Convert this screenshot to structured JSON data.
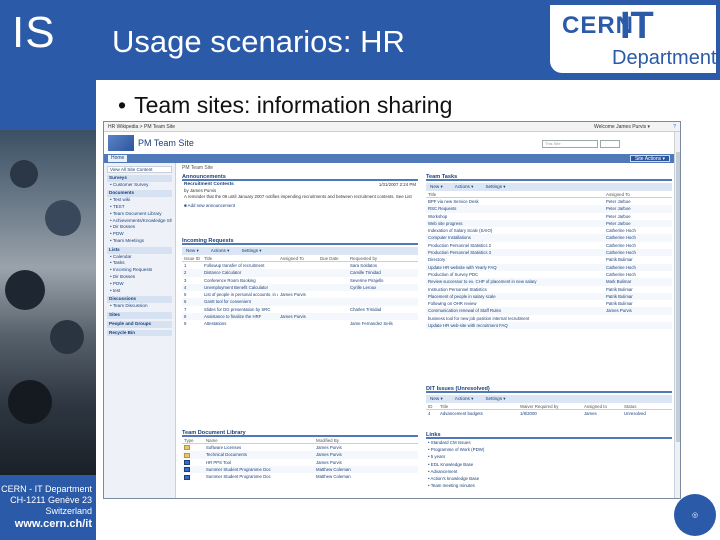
{
  "slide": {
    "logo": "IS",
    "title": "Usage scenarios: HR",
    "cern_logo": {
      "cern": "CERN",
      "it": "IT",
      "department": "Department"
    },
    "bullet": "Team sites: information sharing",
    "footer": {
      "line1": "CERN - IT Department",
      "line2": "CH-1211 Genève 23",
      "line3": "Switzerland",
      "web": "www.cern.ch/it"
    },
    "colors": {
      "brand_blue": "#2a5aa8",
      "sp_blue": "#4f79b8"
    }
  },
  "sharepoint": {
    "breadcrumb": "HR Wikipedia > PM Team Site",
    "welcome": "Welcome James Purvis ▾",
    "help_icon": "help-icon",
    "site_title": "PM Team Site",
    "search_placeholder": "This Site",
    "tab_home": "Home",
    "site_actions": "Site Actions ▾",
    "page_title": "PM Team Site",
    "quick_launch": {
      "view_all": "View All Site Content",
      "sections": [
        {
          "head": "Surveys",
          "items": [
            "Customer Survey"
          ]
        },
        {
          "head": "Documents",
          "items": [
            "Test wiki",
            "TEST",
            "Team Document Library",
            "Achievements/Knowledge Sharing",
            "Dir Bosses",
            "PDW",
            "Team Meetings"
          ]
        },
        {
          "head": "Lists",
          "items": [
            "Calendar",
            "Tasks",
            "Incoming Requests",
            "Dir Bosses",
            "PDW",
            "test"
          ]
        },
        {
          "head": "Discussions",
          "items": [
            "Team Discussion"
          ]
        },
        {
          "head": "Sites",
          "items": []
        },
        {
          "head": "People and Groups",
          "items": []
        },
        {
          "head": "Recycle Bin",
          "items": []
        }
      ]
    },
    "announcements": {
      "title": "Announcements",
      "item_title": "Recruitment Contests",
      "item_author": "by James Purvis",
      "item_date": "1/31/2007 2:24 PM",
      "item_body": "A reminder that the 06 until January 2007 notifies impending recruitments and between recruitment contests. See List",
      "add_link": "Add new announcement"
    },
    "incoming": {
      "title": "Incoming Requests",
      "toolbar": [
        "New ▾",
        "Actions ▾",
        "Settings ▾"
      ],
      "columns": [
        "Issue ID",
        "Title",
        "Assigned To",
        "Due Date",
        "Requested by"
      ],
      "rows": [
        [
          "1",
          "Followup transfer of recruitment",
          "",
          "",
          "Sara Soldatos"
        ],
        [
          "2",
          "Distance Calculator",
          "",
          "",
          "Camille Trinidad"
        ],
        [
          "3",
          "Conference Room Booking",
          "",
          "",
          "Severine Pirajello"
        ],
        [
          "4",
          "Unemployment Benefit Calculator",
          "",
          "",
          "Cyrille Leroux"
        ],
        [
          "5",
          "List of people in personal accounts, in details to Sara",
          "James Purvis",
          "",
          ""
        ],
        [
          "6",
          "Gantt tool for convenient",
          "",
          "",
          ""
        ],
        [
          "7",
          "Slides for DG presentation by SRC",
          "",
          "",
          "Charles Trinidad"
        ],
        [
          "8",
          "Assistance to finalize the HRF",
          "James Purvis",
          "",
          ""
        ],
        [
          "9",
          "Attestations",
          "",
          "",
          "Jame Fernandez Seils"
        ]
      ]
    },
    "doclib": {
      "title": "Team Document Library",
      "columns": [
        "Type",
        "Name",
        "Modified By"
      ],
      "rows": [
        [
          "folder",
          "Software Licenses",
          "James Purvis"
        ],
        [
          "folder",
          "Technical Documents",
          "James Purvis"
        ],
        [
          "doc",
          "HR PPS Tool",
          "James Purvis"
        ],
        [
          "doc",
          "Summer Student Programme Doc",
          "Matthew Coleman"
        ],
        [
          "doc",
          "Summer Student Programme Doc",
          "Matthew Coleman"
        ]
      ]
    },
    "tasks": {
      "title": "Team Tasks",
      "toolbar": [
        "New ▾",
        "Actions ▾",
        "Settings ▾"
      ],
      "columns": [
        "Title",
        "Assigned To"
      ],
      "rows": [
        [
          "BPF via new Service Desk",
          "Peter Jarboe"
        ],
        [
          "RSC Requests",
          "Peter Jarboe"
        ],
        [
          "Workshop",
          "Peter Jarboe"
        ],
        [
          "Web site progress",
          "Peter Jarboe"
        ],
        [
          "Indexation of Salary Scale (SAIO)",
          "Catherine Hoch"
        ],
        [
          "Computer Installations",
          "Catherine Hoch"
        ],
        [
          "Production Personnel Statistics 2",
          "Catherine Hoch"
        ],
        [
          "Production Personnel Statistics 3",
          "Catherine Hoch"
        ],
        [
          "Directory",
          "Patrik Bulimar"
        ],
        [
          "Update HR website with Yearly FAQ",
          "Catherine Hoch"
        ],
        [
          "Production of Survey PDC",
          "Catherine Hoch"
        ],
        [
          "Review successor to ex. CHP of placement in new salary",
          "Mark Bulimar"
        ],
        [
          "Instruction Personnel Statistics",
          "Patrik Bulimar"
        ],
        [
          "Placement of people in salary scale",
          "Patrik Bulimar"
        ],
        [
          "Following on OHR review",
          "Patrik Bulimar"
        ],
        [
          "Communication renewal of Staff Rules",
          "James Purvis"
        ],
        [
          "business tool for new job position internal recruitment",
          ""
        ],
        [
          "Update HR web-site with recruitment FAQ",
          ""
        ]
      ]
    },
    "dit_issues": {
      "title": "DIT Issues (Unresolved)",
      "toolbar": [
        "New ▾",
        "Actions ▾",
        "Settings ▾"
      ],
      "columns": [
        "ID",
        "Title",
        "Waiver Required by",
        "Assigned to",
        "Status"
      ],
      "rows": [
        [
          "4",
          "Advancement budgets",
          "1/8/2000",
          "James",
          "Unresolved"
        ]
      ]
    },
    "links": {
      "title": "Links",
      "items": [
        "Standard CM Issues",
        "Programme of Work (PDW)",
        "5 years",
        "EDL Knowledge Base",
        "Advancement",
        "Action's knowledge Base",
        "Team meeting minutes"
      ]
    }
  }
}
